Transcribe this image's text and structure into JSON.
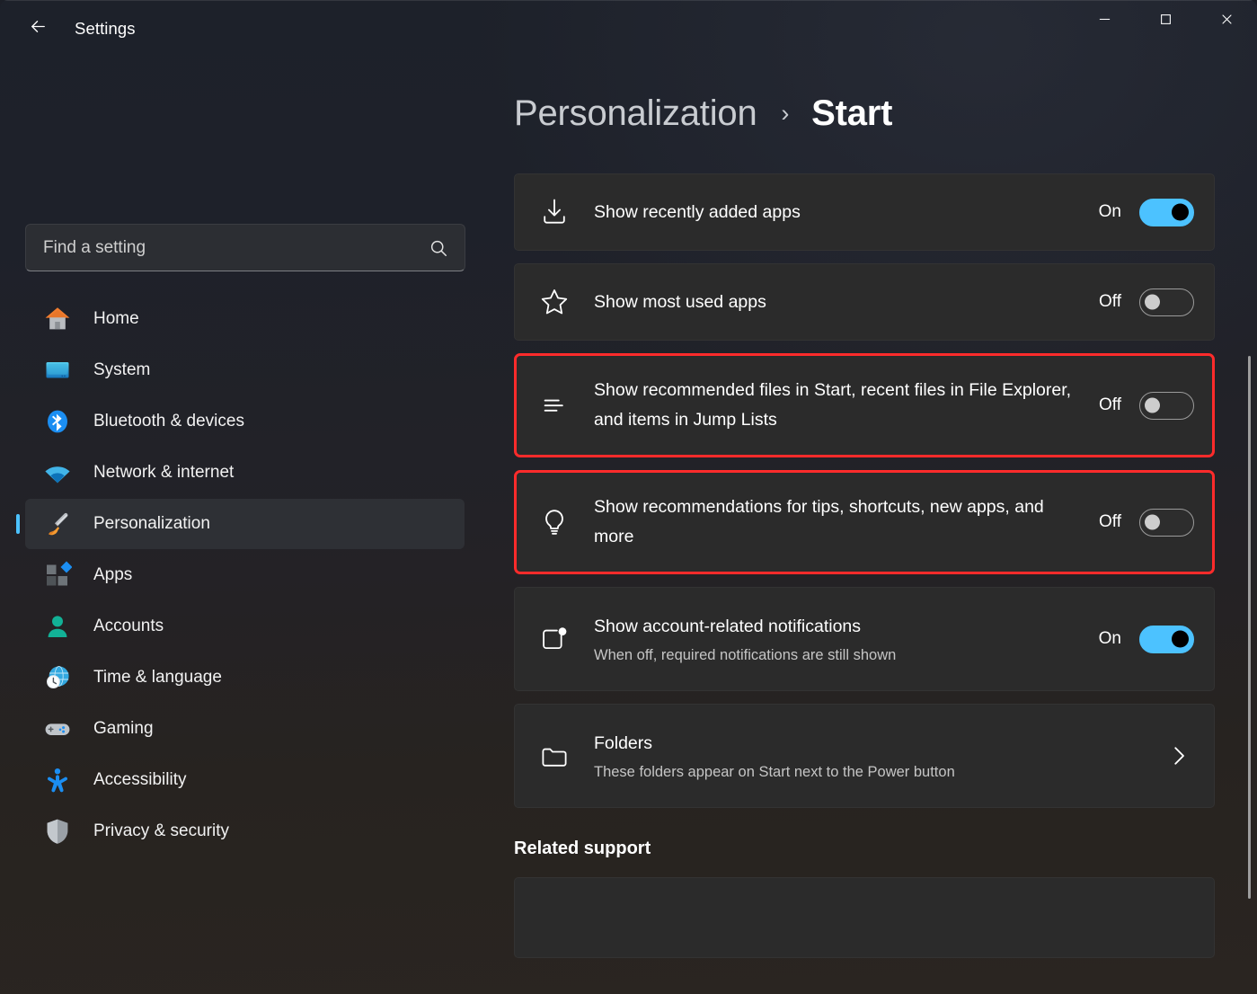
{
  "window": {
    "app_title": "Settings",
    "back_icon": "back-arrow-icon",
    "controls": {
      "minimize": "minimize-icon",
      "maximize": "maximize-icon",
      "close": "close-icon"
    }
  },
  "colors": {
    "accent": "#4cc2ff",
    "highlight_border": "#ff2b2b",
    "card_bg": "#2b2b2b",
    "selected_nav_bg": "#2e3035"
  },
  "search": {
    "placeholder": "Find a setting",
    "value": "",
    "icon": "search-icon"
  },
  "sidebar": {
    "items": [
      {
        "label": "Home",
        "icon": "home-icon",
        "selected": false
      },
      {
        "label": "System",
        "icon": "system-monitor-icon",
        "selected": false
      },
      {
        "label": "Bluetooth & devices",
        "icon": "bluetooth-icon",
        "selected": false
      },
      {
        "label": "Network & internet",
        "icon": "wifi-icon",
        "selected": false
      },
      {
        "label": "Personalization",
        "icon": "paintbrush-icon",
        "selected": true
      },
      {
        "label": "Apps",
        "icon": "apps-icon",
        "selected": false
      },
      {
        "label": "Accounts",
        "icon": "account-person-icon",
        "selected": false
      },
      {
        "label": "Time & language",
        "icon": "clock-globe-icon",
        "selected": false
      },
      {
        "label": "Gaming",
        "icon": "gamepad-icon",
        "selected": false
      },
      {
        "label": "Accessibility",
        "icon": "accessibility-person-icon",
        "selected": false
      },
      {
        "label": "Privacy & security",
        "icon": "shield-icon",
        "selected": false
      }
    ]
  },
  "header": {
    "breadcrumb_parent": "Personalization",
    "breadcrumb_separator": "›",
    "breadcrumb_current": "Start"
  },
  "main": {
    "settings": [
      {
        "title": "Show recently added apps",
        "subtitle": "",
        "icon": "download-icon",
        "control": "toggle",
        "state_label": "On",
        "state": "on",
        "highlighted": false
      },
      {
        "title": "Show most used apps",
        "subtitle": "",
        "icon": "star-icon",
        "control": "toggle",
        "state_label": "Off",
        "state": "off",
        "highlighted": false
      },
      {
        "title": "Show recommended files in Start, recent files in File Explorer, and items in Jump Lists",
        "subtitle": "",
        "icon": "list-lines-icon",
        "control": "toggle",
        "state_label": "Off",
        "state": "off",
        "highlighted": true
      },
      {
        "title": "Show recommendations for tips, shortcuts, new apps, and more",
        "subtitle": "",
        "icon": "lightbulb-icon",
        "control": "toggle",
        "state_label": "Off",
        "state": "off",
        "highlighted": true
      },
      {
        "title": "Show account-related notifications",
        "subtitle": "When off, required notifications are still shown",
        "icon": "notification-badge-icon",
        "control": "toggle",
        "state_label": "On",
        "state": "on",
        "highlighted": false
      },
      {
        "title": "Folders",
        "subtitle": "These folders appear on Start next to the Power button",
        "icon": "folder-icon",
        "control": "chevron",
        "state_label": "",
        "state": "",
        "highlighted": false
      }
    ],
    "related_support_heading": "Related support"
  }
}
